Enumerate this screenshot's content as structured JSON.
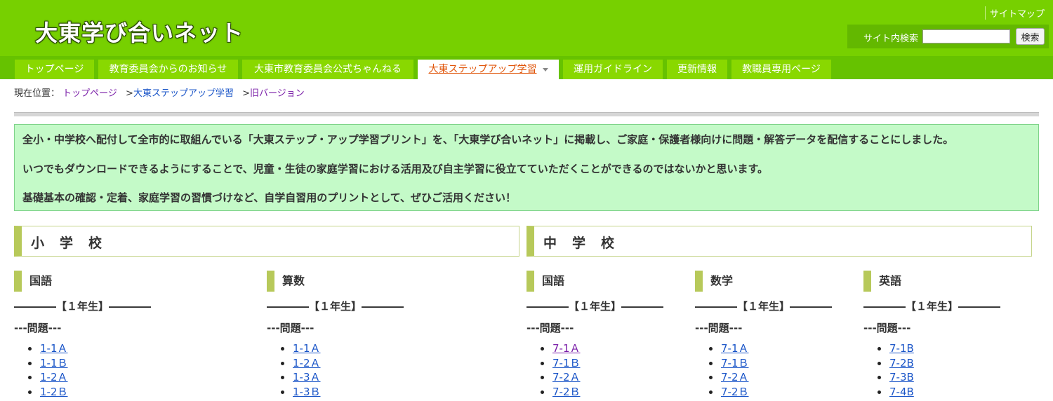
{
  "header": {
    "site_title": "大東学び合いネット",
    "sitemap_label": "サイトマップ",
    "search_label": "サイト内検索",
    "search_value": "",
    "search_button": "検索"
  },
  "nav": {
    "items": [
      {
        "label": "トップページ"
      },
      {
        "label": "教育委員会からのお知らせ"
      },
      {
        "label": "大東市教育委員会公式ちゃんねる"
      },
      {
        "label": "大東ステップアップ学習"
      },
      {
        "label": "運用ガイドライン"
      },
      {
        "label": "更新情報"
      },
      {
        "label": "教職員専用ページ"
      }
    ],
    "active_index": 3
  },
  "breadcrumb": {
    "prefix": "現在位置：",
    "items": [
      "トップページ",
      "大東ステップアップ学習",
      "旧バージョン"
    ],
    "separator": ">"
  },
  "notice": {
    "lines": [
      "全小・中学校へ配付して全市的に取組んでいる「大東ステップ・アップ学習プリント」を、「大東学び合いネット」に掲載し、ご家庭・保護者様向けに問題・解答データを配信することにしました。",
      "いつでもダウンロードできるようにすることで、児童・生徒の家庭学習における活用及び自主学習に役立てていただくことができるのではないかと思います。",
      "基礎基本の確認・定着、家庭学習の習慣づけなど、自学自習用のプリントとして、ぜひご活用ください！"
    ]
  },
  "sections": {
    "elementary": "小学校",
    "junior_high": "中学校"
  },
  "columns": [
    {
      "subject": "国語",
      "grade": "――――【１年生】――――",
      "label": "---問題---",
      "links": [
        "1-1Ａ",
        "1-1Ｂ",
        "1-2Ａ",
        "1-2Ｂ"
      ]
    },
    {
      "subject": "算数",
      "grade": "――――【１年生】――――",
      "label": "---問題---",
      "links": [
        "1-1Ａ",
        "1-2Ａ",
        "1-3Ａ",
        "1-3Ｂ"
      ]
    },
    {
      "subject": "国語",
      "grade": "――――【１年生】――――",
      "label": "---問題---",
      "links": [
        "7-1Ａ",
        "7-1Ｂ",
        "7-2Ａ",
        "7-2Ｂ"
      ]
    },
    {
      "subject": "数学",
      "grade": "――――【１年生】――――",
      "label": "---問題---",
      "links": [
        "7-1Ａ",
        "7-1Ｂ",
        "7-2Ａ",
        "7-2Ｂ"
      ]
    },
    {
      "subject": "英語",
      "grade": "――――【１年生】――――",
      "label": "---問題---",
      "links": [
        "7-1B",
        "7-2B",
        "7-3B",
        "7-4B"
      ]
    }
  ],
  "colors": {
    "header_green": "#77d000",
    "nav_green": "#66c200",
    "active_tab_text": "#e0550a",
    "notice_bg": "#c4fac8",
    "accent_bar": "#b7c95a",
    "link": "#1a55c8",
    "visited_link": "#7a1ea8"
  }
}
